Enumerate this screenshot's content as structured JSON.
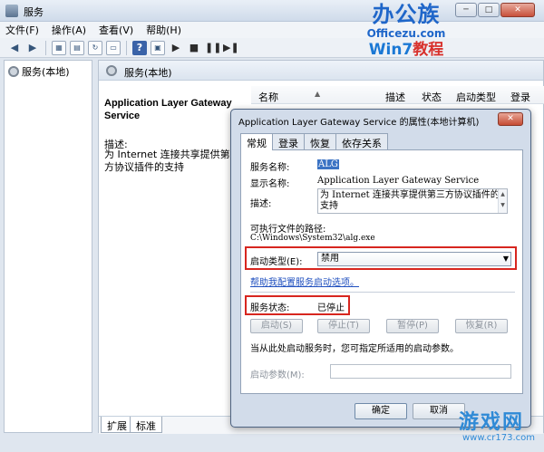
{
  "window": {
    "title": "服务"
  },
  "menu": [
    "文件(F)",
    "操作(A)",
    "查看(V)",
    "帮助(H)"
  ],
  "logo": {
    "brand": "办公族",
    "url": "Officezu.com",
    "tag_prefix": "Win7",
    "tag_suffix": "教程"
  },
  "tree": {
    "root": "服务(本地)"
  },
  "panel": {
    "header": "服务(本地)",
    "service_title": "Application Layer Gateway Service",
    "desc_label": "描述:",
    "desc_text": "为 Internet 连接共享提供第三方协议插件的支持",
    "columns": [
      "名称",
      "描述",
      "状态",
      "启动类型",
      "登录"
    ],
    "bottom_tabs": [
      "扩展",
      "标准"
    ]
  },
  "dialog": {
    "title": "Application Layer Gateway Service 的属性(本地计算机)",
    "tabs": [
      "常规",
      "登录",
      "恢复",
      "依存关系"
    ],
    "service_name_label": "服务名称:",
    "service_name": "ALG",
    "display_name_label": "显示名称:",
    "display_name": "Application Layer Gateway Service",
    "description_label": "描述:",
    "description": "为 Internet 连接共享提供第三方协议插件的支持",
    "exe_path_label": "可执行文件的路径:",
    "exe_path": "C:\\Windows\\System32\\alg.exe",
    "startup_type_label": "启动类型(E):",
    "startup_type": "禁用",
    "help_link": "帮助我配置服务启动选项。",
    "status_label": "服务状态:",
    "status": "已停止",
    "buttons": {
      "start": "启动(S)",
      "stop": "停止(T)",
      "pause": "暂停(P)",
      "resume": "恢复(R)"
    },
    "hint": "当从此处启动服务时，您可指定所适用的启动参数。",
    "params_label": "启动参数(M):",
    "ok": "确定",
    "cancel": "取消"
  },
  "watermark": {
    "brand": "游戏网",
    "site": "www.cr173.com"
  },
  "colors": {
    "highlight_box": "#d7261f",
    "link": "#1f4fbf",
    "logo_blue": "#1f66c9"
  },
  "icons": {
    "back": "left-arrow-icon",
    "forward": "right-arrow-icon",
    "help": "help-icon",
    "play": "play-icon",
    "stop": "stop-icon",
    "pause": "pause-icon",
    "restart": "restart-icon"
  }
}
